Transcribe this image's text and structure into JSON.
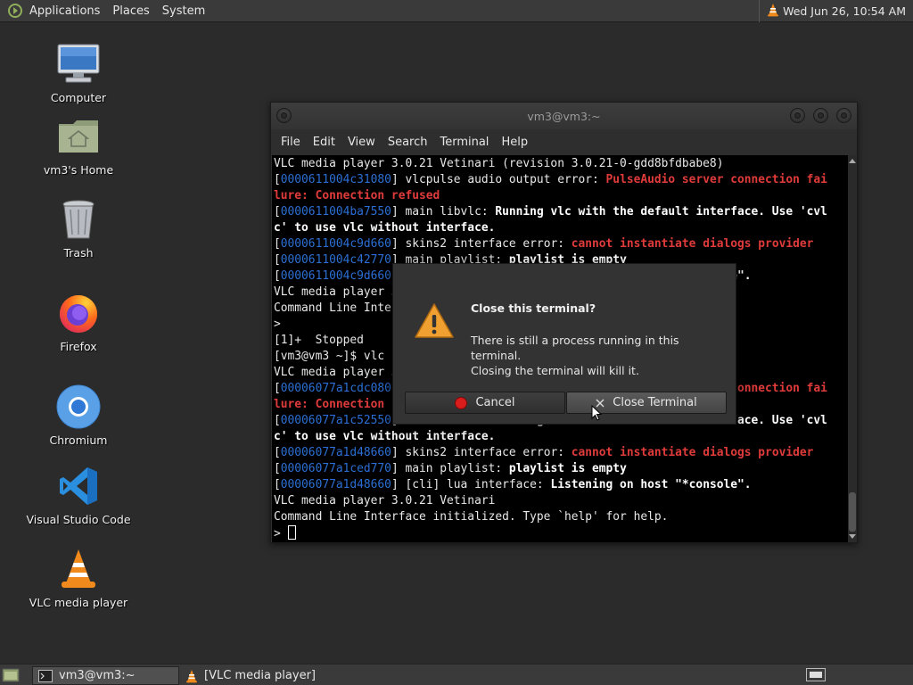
{
  "top_panel": {
    "menus": [
      "Applications",
      "Places",
      "System"
    ],
    "clock": "Wed Jun 26, 10:54 AM"
  },
  "desktop_icons": [
    {
      "label": "Computer",
      "icon": "computer-icon"
    },
    {
      "label": "vm3's Home",
      "icon": "home-folder-icon"
    },
    {
      "label": "Trash",
      "icon": "trash-icon"
    },
    {
      "label": "Firefox",
      "icon": "firefox-icon"
    },
    {
      "label": "Chromium",
      "icon": "chromium-icon"
    },
    {
      "label": "Visual Studio Code",
      "icon": "vscode-icon"
    },
    {
      "label": "VLC media player",
      "icon": "vlc-icon"
    }
  ],
  "terminal": {
    "title": "vm3@vm3:~",
    "menu": [
      "File",
      "Edit",
      "View",
      "Search",
      "Terminal",
      "Help"
    ],
    "lines": [
      [
        {
          "t": "VLC media player 3.0.21 Vetinari (revision 3.0.21-0-gdd8bfdbabe8)"
        }
      ],
      [
        {
          "t": "[",
          "c": ""
        },
        {
          "t": "0000611004c31080",
          "c": "blue"
        },
        {
          "t": "] vlcpulse audio output error: "
        },
        {
          "t": "PulseAudio server connection fai",
          "c": "red"
        }
      ],
      [
        {
          "t": "lure: Connection refused",
          "c": "red"
        }
      ],
      [
        {
          "t": "["
        },
        {
          "t": "0000611004ba7550",
          "c": "blue"
        },
        {
          "t": "] main libvlc: "
        },
        {
          "t": "Running vlc with the default interface. Use 'cvl",
          "c": "bold"
        }
      ],
      [
        {
          "t": "c' to use vlc without interface.",
          "c": "bold"
        }
      ],
      [
        {
          "t": "["
        },
        {
          "t": "0000611004c9d660",
          "c": "blue"
        },
        {
          "t": "] skins2 interface error: "
        },
        {
          "t": "cannot instantiate dialogs provider",
          "c": "red"
        }
      ],
      [
        {
          "t": "["
        },
        {
          "t": "0000611004c42770",
          "c": "blue"
        },
        {
          "t": "] main playlist: "
        },
        {
          "t": "playlist is empty",
          "c": "bold"
        }
      ],
      [
        {
          "t": "["
        },
        {
          "t": "0000611004c9d660",
          "c": "blue"
        },
        {
          "t": "] [cli] lua interface: "
        },
        {
          "t": "Listening on host \"*console\".",
          "c": "bold"
        }
      ],
      [
        {
          "t": "VLC media player 3.0.21 Vetinari"
        }
      ],
      [
        {
          "t": "Command Line Interface initialized. Type `help' for help."
        }
      ],
      [
        {
          "t": ">"
        }
      ],
      [
        {
          "t": "[1]+  Stopped                 vlc"
        }
      ],
      [
        {
          "t": "[vm3@vm3 ~]$ vlc"
        }
      ],
      [
        {
          "t": "VLC media player 3.0.21 Vetinari (revision 3.0.21-0-gdd8bfdbabe8)"
        }
      ],
      [
        {
          "t": "["
        },
        {
          "t": "00006077a1cdc080",
          "c": "blue"
        },
        {
          "t": "] vlcpulse audio output error: "
        },
        {
          "t": "PulseAudio server connection fai",
          "c": "red"
        }
      ],
      [
        {
          "t": "lure: Connection refused",
          "c": "red"
        }
      ],
      [
        {
          "t": "["
        },
        {
          "t": "00006077a1c52550",
          "c": "blue"
        },
        {
          "t": "] main libvlc: "
        },
        {
          "t": "Running vlc with the default interface. Use 'cvl",
          "c": "bold"
        }
      ],
      [
        {
          "t": "c' to use vlc without interface.",
          "c": "bold"
        }
      ],
      [
        {
          "t": "["
        },
        {
          "t": "00006077a1d48660",
          "c": "blue"
        },
        {
          "t": "] skins2 interface error: "
        },
        {
          "t": "cannot instantiate dialogs provider",
          "c": "red"
        }
      ],
      [
        {
          "t": "["
        },
        {
          "t": "00006077a1ced770",
          "c": "blue"
        },
        {
          "t": "] main playlist: "
        },
        {
          "t": "playlist is empty",
          "c": "bold"
        }
      ],
      [
        {
          "t": "["
        },
        {
          "t": "00006077a1d48660",
          "c": "blue"
        },
        {
          "t": "] [cli] lua interface: "
        },
        {
          "t": "Listening on host \"*console\".",
          "c": "bold"
        }
      ],
      [
        {
          "t": "VLC media player 3.0.21 Vetinari"
        }
      ],
      [
        {
          "t": "Command Line Interface initialized. Type `help' for help."
        }
      ],
      [
        {
          "t": "> "
        }
      ]
    ]
  },
  "dialog": {
    "title": "Close this terminal?",
    "message_line1": "There is still a process running in this terminal.",
    "message_line2": "Closing the terminal will kill it.",
    "cancel_label": "Cancel",
    "close_label": "Close Terminal"
  },
  "taskbar": {
    "tasks": [
      {
        "label": "vm3@vm3:~",
        "active": true
      },
      {
        "label": "[VLC media player]",
        "active": false
      }
    ]
  },
  "colors": {
    "blue": "#2c6fd4",
    "red": "#e03b3b",
    "warning": "#f0a030"
  }
}
